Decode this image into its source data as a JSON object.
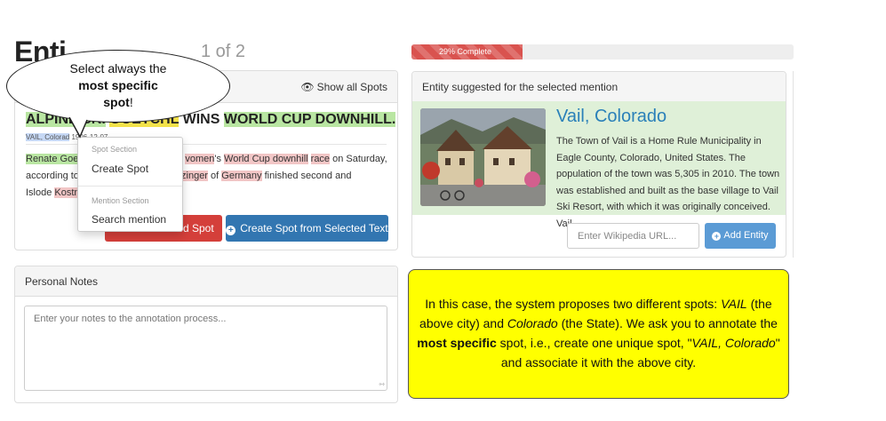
{
  "header": {
    "title": "Enti",
    "subtitle": "1 of 2"
  },
  "document_panel": {
    "show_all_label": "Show all Spots",
    "doc_title": {
      "part1": "ALPINE SKI",
      "part2": "GOETCHL",
      "part3": " WINS ",
      "part4": "WORLD CUP DOWNHILL."
    },
    "meta": {
      "place": "VAIL, Colorad",
      "date": "1996-12-07"
    },
    "body": {
      "t1": "Renate Goe",
      "t2": "vomen",
      "t3": "'s ",
      "t4": "World Cup downhill",
      "t5": " ",
      "t6": "race",
      "t7": " on Saturday,",
      "t8": "according to",
      "t9": "a Seizinger",
      "t10": " of ",
      "t11": "Germany",
      "t12": " finished second and",
      "t13": "Islode ",
      "t14": "Kostn"
    },
    "delete_button": "ed Spot",
    "create_from_text_button": "Create Spot from Selected Text"
  },
  "dropdown": {
    "spot_section_header": "Spot Section",
    "create_spot": "Create Spot",
    "mention_section_header": "Mention Section",
    "search_mention": "Search mention"
  },
  "callout": {
    "line1": "Select always the",
    "line2": "most specific",
    "line3_bold": "spot",
    "line3_rest": "!"
  },
  "notes_panel": {
    "title": "Personal Notes",
    "placeholder": "Enter your notes to the annotation process..."
  },
  "progress": {
    "label": "29% Complete",
    "value_percent": 29,
    "color": "#d9534f"
  },
  "entity_panel": {
    "title": "Entity suggested for the selected mention",
    "entity_name": "Vail, Colorado",
    "entity_description": "The Town of Vail is a Home Rule Municipality in Eagle County, Colorado, United States. The population of the town was 5,305 in 2010. The town was established and built as the base village to Vail Ski Resort, with which it was originally conceived. Vail ...",
    "wiki_url_placeholder": "Enter Wikipedia URL...",
    "add_entity_button": "Add Entity"
  },
  "explanation": {
    "p1": "In this case, the system proposes two different spots: ",
    "vail": "VAIL",
    "p2": " (the above city) and ",
    "colorado": "Colorado",
    "p3": " (the State). We ask you to annotate the ",
    "most_specific": "most specific",
    "p4": " spot, i.e., create one unique spot, \"",
    "vail_colorado": "VAIL, Colorado",
    "p5": "\" and associate it with the above city."
  }
}
